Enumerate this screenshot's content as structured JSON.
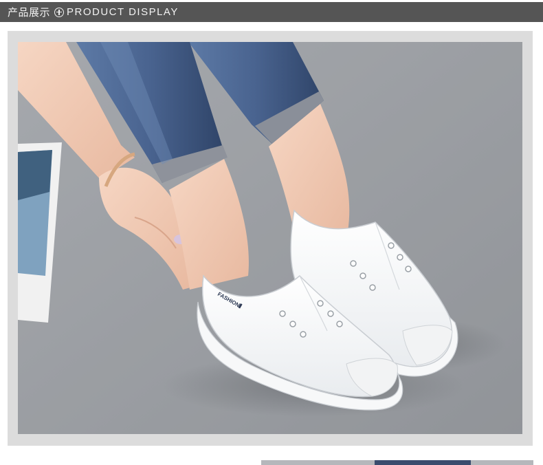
{
  "header": {
    "title_cn": "产品展示",
    "title_en": "PRODUCT DISPLAY",
    "icon": "plus-circle-icon",
    "bar_color": "#555555"
  },
  "photo": {
    "shoe_label": "FASHION"
  }
}
